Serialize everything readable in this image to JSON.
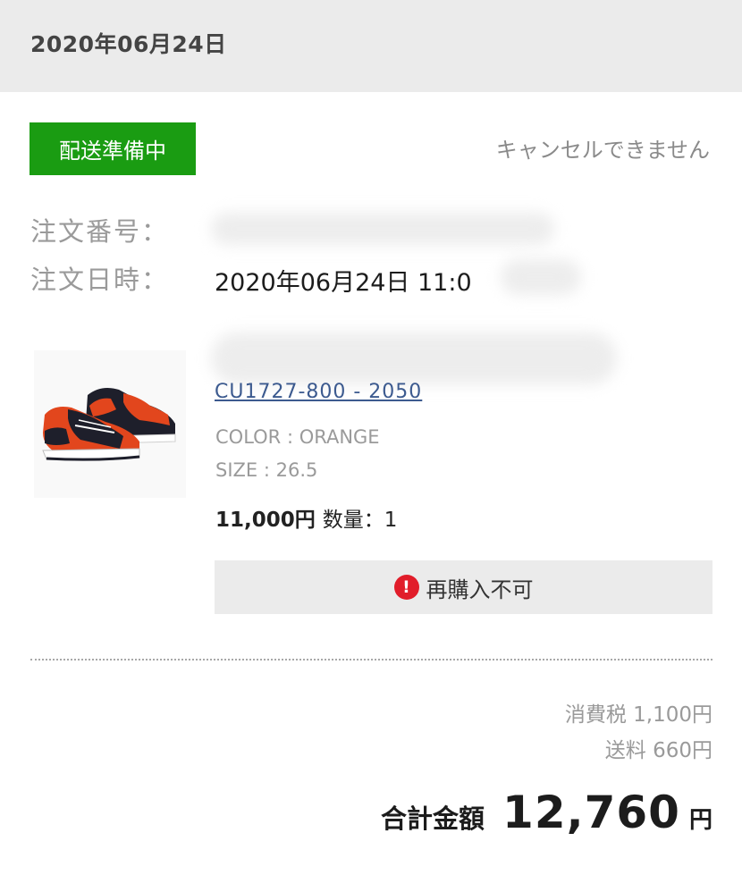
{
  "header": {
    "date": "2020年06月24日"
  },
  "status": {
    "badge": "配送準備中",
    "cancel_note": "キャンセルできません"
  },
  "order": {
    "number_label": "注文番号：",
    "number_value": "",
    "datetime_label": "注文日時：",
    "datetime_value": "2020年06月24日 11:0"
  },
  "product": {
    "link_text": "CU1727-800 - 2050",
    "color": "COLOR : ORANGE",
    "size": "SIZE : 26.5",
    "price": "11,000円",
    "quantity": "数量：1",
    "image_icon": "sneaker-image",
    "colors": {
      "upper": "#e2461d",
      "overlay": "#1e1f2b",
      "sole": "#ffffff"
    }
  },
  "rebuy": {
    "text": "再購入不可",
    "icon": "warning-icon",
    "icon_color": "#e11d2a"
  },
  "fees": {
    "tax": "消費税 1,100円",
    "shipping": "送料 660円"
  },
  "total": {
    "label": "合計金額",
    "amount": "12,760",
    "unit": "円"
  },
  "colors": {
    "status_green": "#1a9c12",
    "header_gray": "#ebebeb",
    "link_blue": "#3c5a8f"
  }
}
